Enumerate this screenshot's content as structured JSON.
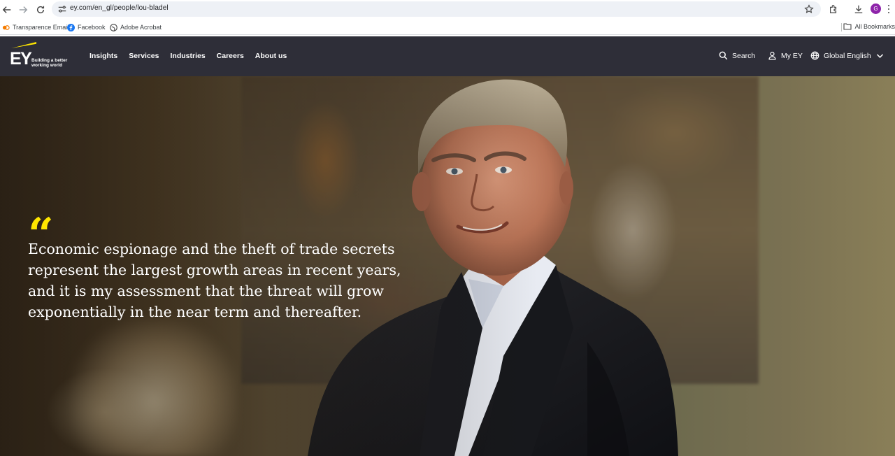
{
  "browser": {
    "url": "ey.com/en_gl/people/lou-bladel",
    "profile_initial": "G",
    "bookmarks": [
      {
        "label": "Transparence Email",
        "icon": "link-icon"
      },
      {
        "label": "Facebook",
        "icon": "facebook-icon"
      },
      {
        "label": "Adobe Acrobat",
        "icon": "globe-icon"
      }
    ],
    "all_bookmarks_label": "All Bookmarks"
  },
  "site": {
    "logo_text": "EY",
    "tagline_line1": "Building a better",
    "tagline_line2": "working world",
    "nav": [
      "Insights",
      "Services",
      "Industries",
      "Careers",
      "About us"
    ],
    "search_label": "Search",
    "my_ey_label": "My EY",
    "language_label": "Global English",
    "colors": {
      "header_bg": "#2e2e38",
      "accent": "#ffe600"
    }
  },
  "hero": {
    "quote_mark": "“",
    "quote": "Economic espionage and the theft of trade secrets represent the largest growth areas in recent years, and it is my assessment that the threat will grow exponentially in the near term and thereafter."
  }
}
